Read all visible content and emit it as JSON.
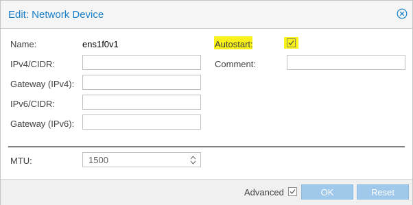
{
  "dialog": {
    "title": "Edit: Network Device"
  },
  "form": {
    "name_label": "Name:",
    "name_value": "ens1f0v1",
    "ipv4_label": "IPv4/CIDR:",
    "ipv4_value": "",
    "gateway4_label": "Gateway (IPv4):",
    "gateway4_value": "",
    "ipv6_label": "IPv6/CIDR:",
    "ipv6_value": "",
    "gateway6_label": "Gateway (IPv6):",
    "gateway6_value": "",
    "autostart_label": "Autostart:",
    "autostart_checked": true,
    "comment_label": "Comment:",
    "comment_value": "",
    "mtu_label": "MTU:",
    "mtu_value": "1500"
  },
  "footer": {
    "advanced_label": "Advanced",
    "advanced_checked": true,
    "ok_label": "OK",
    "reset_label": "Reset"
  },
  "colors": {
    "accent": "#157fcc",
    "highlight": "#f9f21a",
    "button": "#9fc8ea"
  },
  "icons": {
    "close": "close-circle-icon",
    "checkmark": "check-icon",
    "spinner": "spinner-arrows-icon"
  }
}
